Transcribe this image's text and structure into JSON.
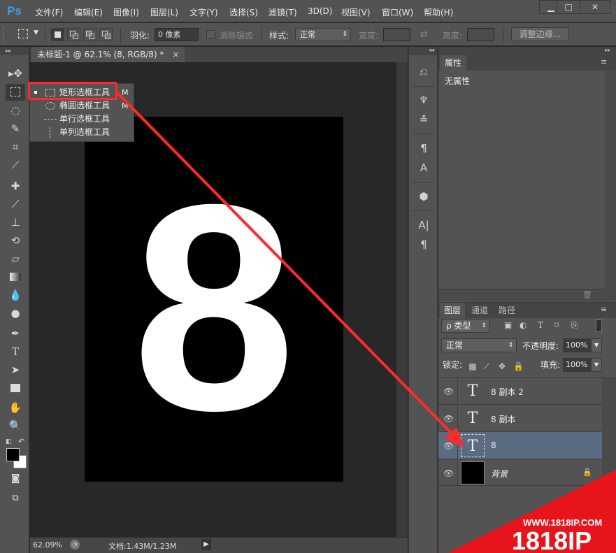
{
  "app": {
    "logo": "Ps"
  },
  "menu": [
    "文件(F)",
    "编辑(E)",
    "图像(I)",
    "图层(L)",
    "文字(Y)",
    "选择(S)",
    "滤镜(T)",
    "3D(D)",
    "视图(V)",
    "窗口(W)",
    "帮助(H)"
  ],
  "window_controls": {
    "minimize": "▁",
    "maximize": "□",
    "close": "✕"
  },
  "options": {
    "feather_label": "羽化:",
    "feather_value": "0 像素",
    "antialias_label": "消除锯齿",
    "style_label": "样式:",
    "style_value": "正常",
    "width_label": "宽度:",
    "height_label": "高度:",
    "refine_edge_label": "调整边缘..."
  },
  "document": {
    "tab_title": "未标题-1 @ 62.1% (8, RGB/8) *",
    "tab_close": "×",
    "canvas_text": "8",
    "zoom": "62.09%",
    "doc_info": "文档:1.43M/1.23M"
  },
  "flyout": {
    "items": [
      {
        "label": "矩形选框工具",
        "key": "M",
        "selected": true
      },
      {
        "label": "椭圆选框工具",
        "key": "M",
        "selected": false
      },
      {
        "label": "单行选框工具",
        "key": "",
        "selected": false
      },
      {
        "label": "单列选框工具",
        "key": "",
        "selected": false
      }
    ]
  },
  "properties": {
    "tab": "属性",
    "content": "无属性",
    "trash": "🗑"
  },
  "layers": {
    "tabs": [
      "图层",
      "通道",
      "路径"
    ],
    "filter_kind": "ρ 类型",
    "blend_mode": "正常",
    "opacity_label": "不透明度:",
    "opacity_value": "100%",
    "lock_label": "锁定:",
    "fill_label": "填充:",
    "fill_value": "100%",
    "rows": [
      {
        "name": "8 副本 2",
        "thumb": "T",
        "selected": false
      },
      {
        "name": "8 副本",
        "thumb": "T",
        "selected": false
      },
      {
        "name": "8",
        "thumb": "T",
        "selected": true
      },
      {
        "name": "背景",
        "thumb": "",
        "selected": false
      }
    ]
  },
  "watermark": {
    "url": "WWW.1818IP.COM",
    "brand": "1818IP"
  },
  "colors": {
    "highlight_red": "#ff2a2a",
    "selected_layer": "#5b6b82",
    "brand_blue": "#3d9ee8"
  }
}
